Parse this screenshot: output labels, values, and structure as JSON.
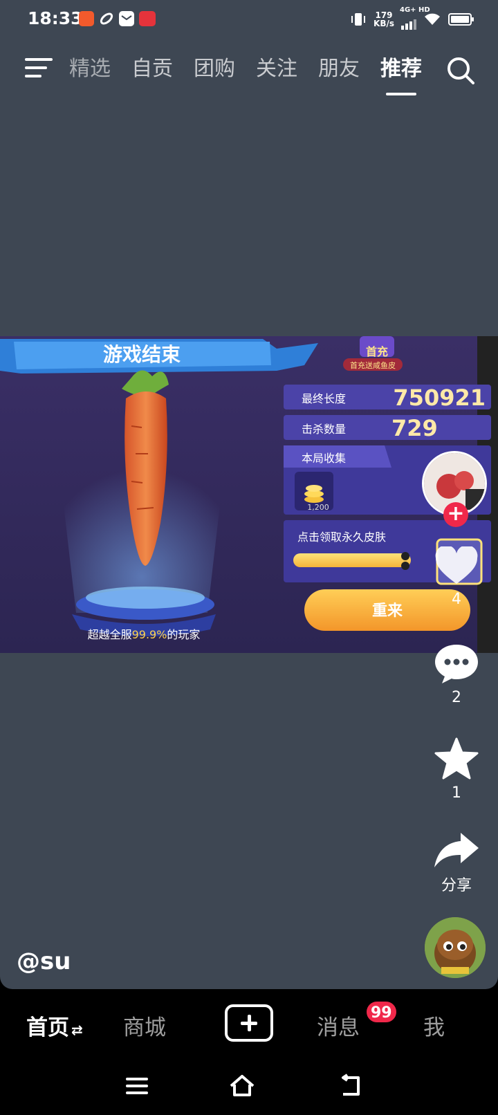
{
  "status_bar": {
    "time": "18:33",
    "net_speed_value": "179",
    "net_speed_unit": "KB/s",
    "network_label": "4G+ HD"
  },
  "top_nav": {
    "tabs": [
      {
        "label": "精选"
      },
      {
        "label": "自贡"
      },
      {
        "label": "团购"
      },
      {
        "label": "关注"
      },
      {
        "label": "朋友"
      },
      {
        "label": "推荐"
      }
    ],
    "active_tab": "推荐"
  },
  "video": {
    "banner_title": "游戏结束",
    "promo_badge": "首充",
    "promo_text": "首充送咸鱼皮",
    "final_length_label": "最终长度",
    "final_length_value": "750921",
    "kills_label": "击杀数量",
    "kills_value": "729",
    "collected_label": "本局收集",
    "coin_amount": "1,200",
    "skin_label": "点击领取永久皮肤",
    "beat_text_prefix": "超越全服",
    "beat_percent": "99.9%",
    "beat_text_suffix": "的玩家",
    "retry_label": "重来"
  },
  "rail": {
    "like_count": "4",
    "comment_count": "2",
    "favorite_count": "1",
    "share_label": "分享"
  },
  "author": {
    "name": "@su"
  },
  "bottom_nav": {
    "home": "首页",
    "mall": "商城",
    "messages": "消息",
    "messages_badge": "99",
    "me": "我"
  }
}
